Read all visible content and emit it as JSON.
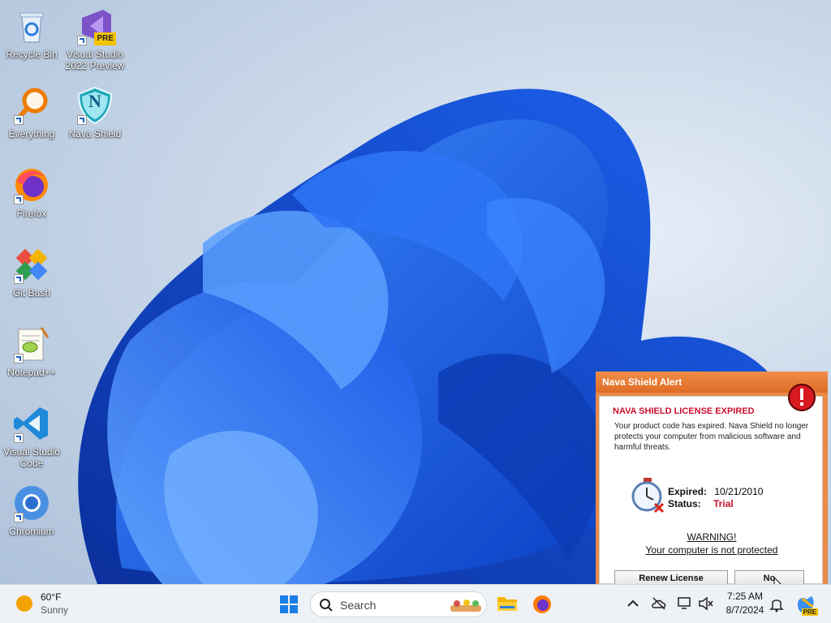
{
  "desktop": {
    "icons": [
      {
        "label": "Recycle Bin",
        "icon": "recycle-bin-icon"
      },
      {
        "label": "Visual Studio 2022 Preview",
        "icon": "visual-studio-preview-icon",
        "badge": "PRE"
      },
      {
        "label": "Everything",
        "icon": "everything-search-icon"
      },
      {
        "label": "Nava Shield",
        "icon": "nava-shield-icon",
        "letter": "N"
      },
      {
        "label": "Firefox",
        "icon": "firefox-icon"
      },
      {
        "label": "Git Bash",
        "icon": "git-bash-icon"
      },
      {
        "label": "Notepad++",
        "icon": "notepad-plus-plus-icon"
      },
      {
        "label": "Visual Studio Code",
        "icon": "vscode-icon"
      },
      {
        "label": "Chromium",
        "icon": "chromium-icon"
      }
    ]
  },
  "alert": {
    "title": "Nava Shield Alert",
    "heading": "NAVA SHIELD LICENSE EXPIRED",
    "body": "Your product code has expired. Nava Shield no longer protects your computer from malicious software and harmful threats.",
    "expired_label": "Expired:",
    "expired_value": "10/21/2010",
    "status_label": "Status:",
    "status_value": "Trial",
    "warning_title": "WARNING!",
    "warning_text": "Your computer is not protected",
    "renew_button": "Renew License",
    "no_button": "No",
    "accent": "#e98a45",
    "danger": "#c8102e"
  },
  "taskbar": {
    "weather_temp": "60°F",
    "weather_desc": "Sunny",
    "search_placeholder": "Search",
    "time": "7:25 AM",
    "date": "8/7/2024",
    "copilot_badge": "PRE"
  }
}
